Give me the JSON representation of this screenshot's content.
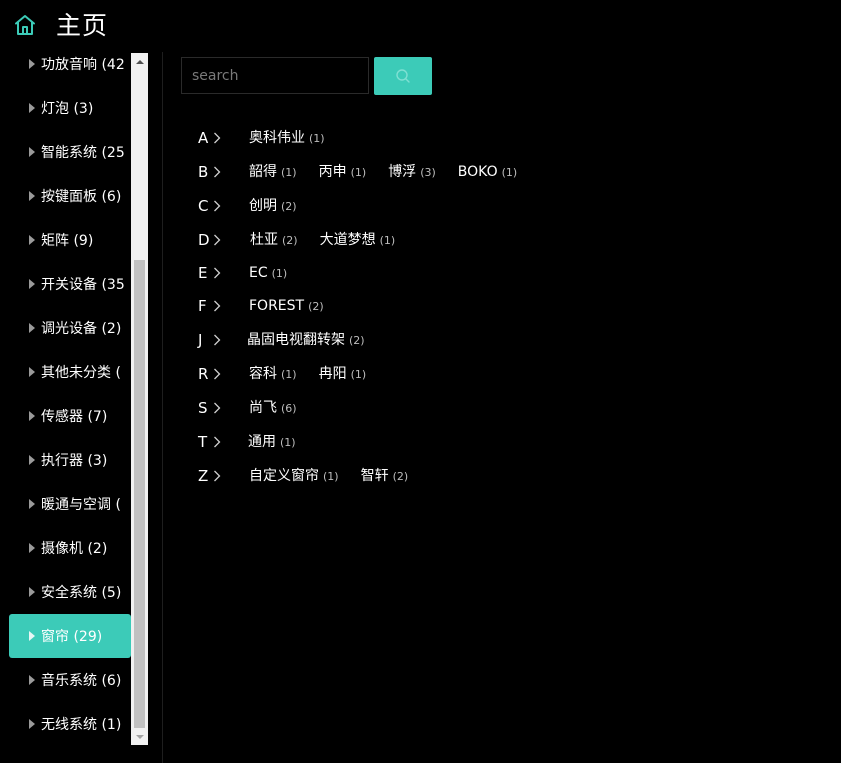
{
  "header": {
    "title": "主页",
    "home_icon": "home-icon",
    "accent_color": "#3ccbb8"
  },
  "sidebar": {
    "items": [
      {
        "label": "功放音响 (42",
        "active": false
      },
      {
        "label": "灯泡 (3)",
        "active": false
      },
      {
        "label": "智能系统 (25",
        "active": false
      },
      {
        "label": "按键面板 (6)",
        "active": false
      },
      {
        "label": "矩阵 (9)",
        "active": false
      },
      {
        "label": "开关设备 (35",
        "active": false
      },
      {
        "label": "调光设备 (2)",
        "active": false
      },
      {
        "label": "其他未分类 (",
        "active": false
      },
      {
        "label": "传感器 (7)",
        "active": false
      },
      {
        "label": "执行器 (3)",
        "active": false
      },
      {
        "label": "暖通与空调 (",
        "active": false
      },
      {
        "label": "摄像机 (2)",
        "active": false
      },
      {
        "label": "安全系统 (5)",
        "active": false
      },
      {
        "label": "窗帘 (29)",
        "active": true
      },
      {
        "label": "音乐系统 (6)",
        "active": false
      },
      {
        "label": "无线系统 (1)",
        "active": false
      }
    ]
  },
  "search": {
    "placeholder": "search",
    "value": "",
    "button_icon": "search-icon"
  },
  "brand_groups": [
    {
      "letter": "A",
      "brands": [
        {
          "name": "奥科伟业",
          "count": "(1)"
        }
      ]
    },
    {
      "letter": "B",
      "brands": [
        {
          "name": "韶得",
          "count": "(1)"
        },
        {
          "name": "丙申",
          "count": "(1)"
        },
        {
          "name": "博浮",
          "count": "(3)"
        },
        {
          "name": "BOKO",
          "count": "(1)"
        }
      ]
    },
    {
      "letter": "C",
      "brands": [
        {
          "name": "创明",
          "count": "(2)"
        }
      ]
    },
    {
      "letter": "D",
      "brands": [
        {
          "name": "杜亚",
          "count": "(2)"
        },
        {
          "name": "大道梦想",
          "count": "(1)"
        }
      ]
    },
    {
      "letter": "E",
      "brands": [
        {
          "name": "EC",
          "count": "(1)"
        }
      ]
    },
    {
      "letter": "F",
      "brands": [
        {
          "name": "FOREST",
          "count": "(2)"
        }
      ]
    },
    {
      "letter": "J",
      "brands": [
        {
          "name": "晶固电视翻转架",
          "count": "(2)"
        }
      ]
    },
    {
      "letter": "R",
      "brands": [
        {
          "name": "容科",
          "count": "(1)"
        },
        {
          "name": "冉阳",
          "count": "(1)"
        }
      ]
    },
    {
      "letter": "S",
      "brands": [
        {
          "name": "尚飞",
          "count": "(6)"
        }
      ]
    },
    {
      "letter": "T",
      "brands": [
        {
          "name": "通用",
          "count": "(1)"
        }
      ]
    },
    {
      "letter": "Z",
      "brands": [
        {
          "name": "自定义窗帘",
          "count": "(1)"
        },
        {
          "name": "智轩",
          "count": "(2)"
        }
      ]
    }
  ]
}
